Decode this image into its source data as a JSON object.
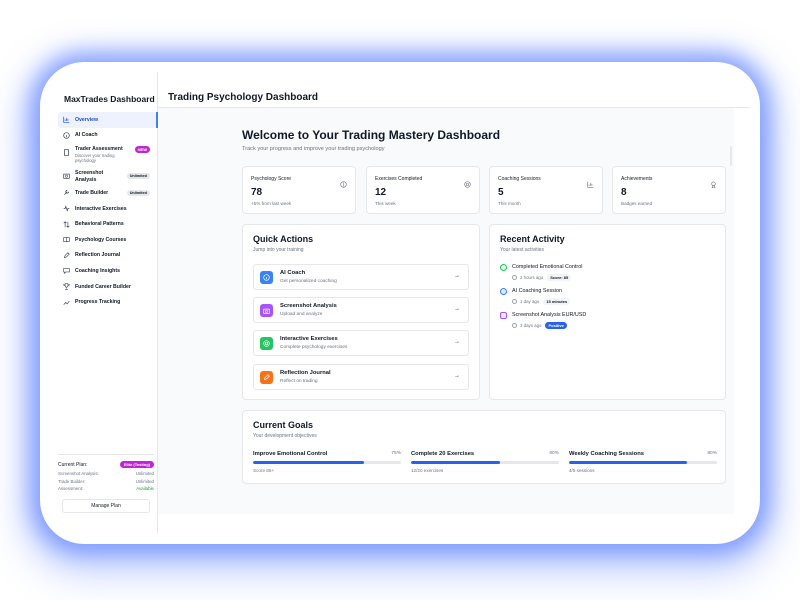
{
  "sidebar": {
    "brand": "MaxTrades Dashboard",
    "items": [
      {
        "label": "Overview",
        "icon": "chart-icon"
      },
      {
        "label": "AI Coach",
        "icon": "info-icon"
      },
      {
        "label": "Trader Assessment",
        "sub": "Discover your trading psychology",
        "badge": "NEW",
        "icon": "document-icon"
      },
      {
        "label": "Screenshot Analysis",
        "badge": "Unlimited",
        "icon": "camera-icon"
      },
      {
        "label": "Trade Builder",
        "badge": "Unlimited",
        "icon": "wrench-icon"
      },
      {
        "label": "Interactive Exercises",
        "icon": "pulse-icon"
      },
      {
        "label": "Behavioral Patterns",
        "icon": "arrows-icon"
      },
      {
        "label": "Psychology Courses",
        "icon": "book-icon"
      },
      {
        "label": "Reflection Journal",
        "icon": "pen-icon"
      },
      {
        "label": "Coaching Insights",
        "icon": "chat-icon"
      },
      {
        "label": "Funded Career Builder",
        "icon": "trophy-icon"
      },
      {
        "label": "Progress Tracking",
        "icon": "trend-icon"
      }
    ],
    "plan": {
      "label": "Current Plan:",
      "badge": "Elite (Testing)",
      "rows": [
        {
          "k": "Screenshot Analysis:",
          "v": "Unlimited"
        },
        {
          "k": "Trade Builder:",
          "v": "Unlimited"
        },
        {
          "k": "Assessment:",
          "v": "Available"
        }
      ],
      "manage": "Manage Plan"
    }
  },
  "header": {
    "title": "Trading Psychology Dashboard"
  },
  "welcome": {
    "title": "Welcome to Your Trading Mastery Dashboard",
    "subtitle": "Track your progress and improve your trading psychology"
  },
  "stats": [
    {
      "label": "Psychology Score",
      "value": "78",
      "sub": "+5% from last week",
      "icon": "brain-icon"
    },
    {
      "label": "Exercises Completed",
      "value": "12",
      "sub": "This week",
      "icon": "target-icon"
    },
    {
      "label": "Coaching Sessions",
      "value": "5",
      "sub": "This month",
      "icon": "bar-chart-icon"
    },
    {
      "label": "Achievements",
      "value": "8",
      "sub": "Badges earned",
      "icon": "award-icon"
    }
  ],
  "quick_actions": {
    "title": "Quick Actions",
    "subtitle": "Jump into your training",
    "items": [
      {
        "title": "AI Coach",
        "sub": "Get personalized coaching",
        "color": "#3b82f6",
        "arrow": "→"
      },
      {
        "title": "Screenshot Analysis",
        "sub": "Upload and analyze",
        "color": "#a855f7",
        "arrow": "→"
      },
      {
        "title": "Interactive Exercises",
        "sub": "Complete psychology exercises",
        "color": "#22c55e",
        "arrow": "→"
      },
      {
        "title": "Reflection Journal",
        "sub": "Reflect on trading",
        "color": "#f97316",
        "arrow": "→"
      }
    ]
  },
  "recent_activity": {
    "title": "Recent Activity",
    "subtitle": "Your latest activities",
    "items": [
      {
        "title": "Completed Emotional Control",
        "time": "2 hours ago",
        "tag": "Score: 85",
        "color": "#22c55e"
      },
      {
        "title": "AI Coaching Session",
        "time": "1 day ago",
        "tag": "15 minutes",
        "color": "#3b82f6"
      },
      {
        "title": "Screenshot Analysis EUR/USD",
        "time": "3 days ago",
        "tag": "Positive",
        "color": "#a855f7"
      }
    ]
  },
  "goals": {
    "title": "Current Goals",
    "subtitle": "Your development objectives",
    "items": [
      {
        "title": "Improve Emotional Control",
        "percent_label": "75%",
        "progress": 0.75,
        "sub": "Score 85+"
      },
      {
        "title": "Complete 20 Exercises",
        "percent_label": "60%",
        "progress": 0.6,
        "sub": "12/20 exercises"
      },
      {
        "title": "Weekly Coaching Sessions",
        "percent_label": "80%",
        "progress": 0.8,
        "sub": "4/5 sessions"
      }
    ]
  },
  "colors": {
    "accent": "#2563eb",
    "badge_purple": "#c026d3",
    "glow": "#466eff"
  }
}
